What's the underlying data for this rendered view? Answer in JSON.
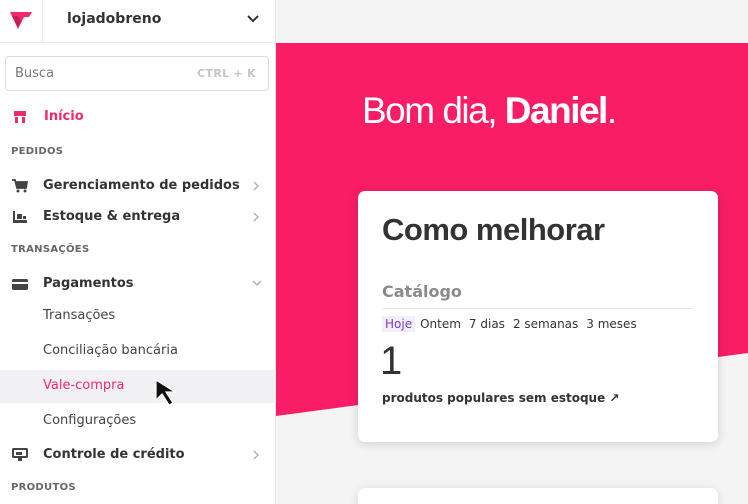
{
  "store": {
    "name": "lojadobreno"
  },
  "search": {
    "placeholder": "Busca",
    "shortcut": "CTRL + K"
  },
  "nav": {
    "inicio": "Início",
    "sections": {
      "pedidos": "PEDIDOS",
      "transacoes": "TRANSAÇÕES",
      "produtos": "PRODUTOS"
    },
    "items": {
      "gerenciamento": "Gerenciamento de pedidos",
      "estoque": "Estoque & entrega",
      "pagamentos": "Pagamentos",
      "controle": "Controle de crédito"
    },
    "sub_items": {
      "transacoes": "Transações",
      "conciliacao": "Conciliação bancária",
      "vale_compra": "Vale-compra",
      "configuracoes": "Configurações"
    }
  },
  "main": {
    "greeting_prefix": "Bom dia,",
    "greeting_name": "Daniel",
    "greeting_suffix": ".",
    "card": {
      "title": "Como melhorar",
      "subtitle": "Catálogo",
      "tabs": [
        "Hoje",
        "Ontem",
        "7 dias",
        "2 semanas",
        "3 meses"
      ],
      "active_tab": "Hoje",
      "metric_value": "1",
      "metric_label": "produtos populares sem estoque ↗"
    }
  },
  "colors": {
    "accent": "#ee2a6a",
    "tab_active": "#7b3fc0"
  }
}
